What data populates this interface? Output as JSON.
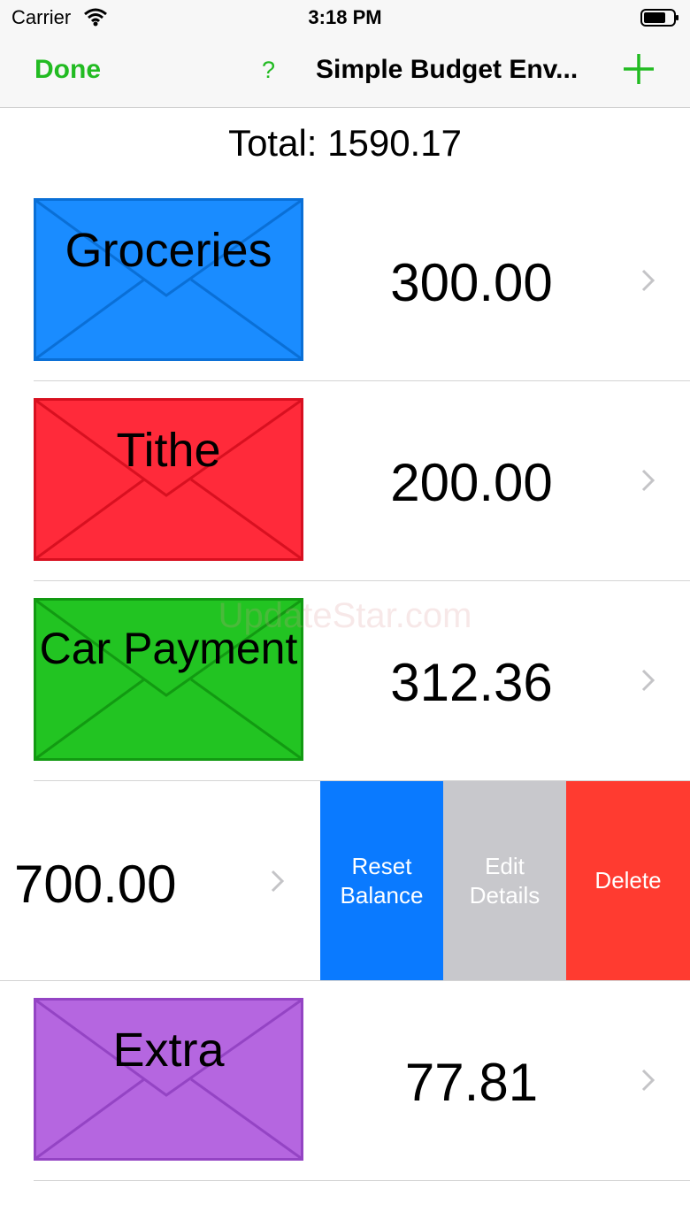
{
  "status": {
    "carrier": "Carrier",
    "time": "3:18 PM"
  },
  "nav": {
    "done": "Done",
    "help": "?",
    "title": "Simple Budget Env..."
  },
  "total": "Total: 1590.17",
  "envelopes": [
    {
      "name": "Groceries",
      "amount": "300.00",
      "color": "#1a8cff"
    },
    {
      "name": "Tithe",
      "amount": "200.00",
      "color": "#ff2a3a"
    },
    {
      "name": "Car Payment",
      "amount": "312.36",
      "color": "#22c422"
    },
    {
      "amount": "700.00"
    },
    {
      "name": "Extra",
      "amount": "77.81",
      "color": "#b566e0"
    }
  ],
  "actions": {
    "reset_line1": "Reset",
    "reset_line2": "Balance",
    "edit_line1": "Edit",
    "edit_line2": "Details",
    "delete": "Delete"
  },
  "watermark": "UpdateStar.com"
}
